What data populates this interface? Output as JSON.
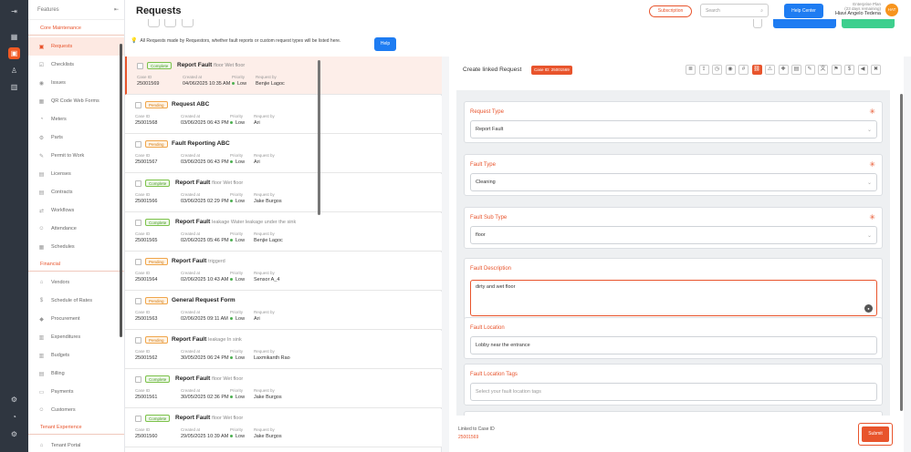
{
  "rail": {
    "icons": [
      "expand-icon",
      "dashboard-icon",
      "requests-icon",
      "hierarchy-icon",
      "reports-icon",
      "settings-icon",
      "help-icon",
      "gear-icon"
    ]
  },
  "sidebar": {
    "header": "Features",
    "sections": [
      {
        "title": "Core Maintenance",
        "items": [
          {
            "label": "Requests",
            "icon": "requests-icon",
            "active": true
          },
          {
            "label": "Checklists",
            "icon": "checklist-icon"
          },
          {
            "label": "Issues",
            "icon": "issues-icon"
          },
          {
            "label": "QR Code Web Forms",
            "icon": "qr-icon"
          },
          {
            "label": "Meters",
            "icon": "meter-icon"
          },
          {
            "label": "Parts",
            "icon": "parts-icon"
          },
          {
            "label": "Permit to Work",
            "icon": "permit-icon"
          },
          {
            "label": "Licenses",
            "icon": "license-icon"
          },
          {
            "label": "Contracts",
            "icon": "contract-icon"
          },
          {
            "label": "Workflows",
            "icon": "workflow-icon"
          },
          {
            "label": "Attendance",
            "icon": "attendance-icon"
          },
          {
            "label": "Schedules",
            "icon": "schedule-icon"
          }
        ]
      },
      {
        "title": "Financial",
        "items": [
          {
            "label": "Vendors",
            "icon": "vendor-icon"
          },
          {
            "label": "Schedule of Rates",
            "icon": "dollar-icon"
          },
          {
            "label": "Procurement",
            "icon": "procurement-icon"
          },
          {
            "label": "Expenditures",
            "icon": "expenditure-icon"
          },
          {
            "label": "Budgets",
            "icon": "budget-icon"
          },
          {
            "label": "Billing",
            "icon": "billing-icon"
          },
          {
            "label": "Payments",
            "icon": "payment-icon"
          },
          {
            "label": "Customers",
            "icon": "customers-icon"
          }
        ]
      },
      {
        "title": "Tenant Experience",
        "items": [
          {
            "label": "Tenant Portal",
            "icon": "portal-icon"
          }
        ]
      }
    ]
  },
  "header": {
    "title": "Requests",
    "subscription": "Subscription",
    "search_placeholder": "Search",
    "help_center": "Help Center",
    "plan": "Enterprise Plan",
    "trial": "(23 days remaining)",
    "user": "Hiavi Angelo Tedena",
    "initials": "HAT",
    "info": "All Requests made by Requestors, whether fault reports or custom request types will be listed here.",
    "help": "Help"
  },
  "list": {
    "labels": {
      "case": "Case ID",
      "created": "Created at",
      "priority": "Priority",
      "requested": "Request by"
    },
    "items": [
      {
        "status": "Complete",
        "title": "Report Fault",
        "sub": "floor Wet floor",
        "id": "25001569",
        "created": "04/06/2025 10:35 AM",
        "priority": "Low",
        "by": "Benjie Lagoc",
        "selected": true
      },
      {
        "status": "Pending",
        "title": "Request ABC",
        "sub": "",
        "id": "25001568",
        "created": "03/06/2025 06:43 PM",
        "priority": "Low",
        "by": "Ari"
      },
      {
        "status": "Pending",
        "title": "Fault Reporting ABC",
        "sub": "",
        "id": "25001567",
        "created": "03/06/2025 06:43 PM",
        "priority": "Low",
        "by": "Ari"
      },
      {
        "status": "Complete",
        "title": "Report Fault",
        "sub": "floor Wet floor",
        "id": "25001566",
        "created": "03/06/2025 02:29 PM",
        "priority": "Low",
        "by": "Jake Burgos"
      },
      {
        "status": "Complete",
        "title": "Report Fault",
        "sub": "leakage Water leakage under the sink",
        "id": "25001565",
        "created": "02/06/2025 05:46 PM",
        "priority": "Low",
        "by": "Benjie Lagoc"
      },
      {
        "status": "Pending",
        "title": "Report Fault",
        "sub": "triggerd",
        "id": "25001564",
        "created": "02/06/2025 10:43 AM",
        "priority": "Low",
        "by": "Sensor A_4"
      },
      {
        "status": "Pending",
        "title": "General Request Form",
        "sub": "",
        "id": "25001563",
        "created": "02/06/2025 09:11 AM",
        "priority": "Low",
        "by": "Ari"
      },
      {
        "status": "Pending",
        "title": "Report Fault",
        "sub": "leakage In sink",
        "id": "25001562",
        "created": "30/05/2025 06:24 PM",
        "priority": "Low",
        "by": "Laxmikanth Rao"
      },
      {
        "status": "Complete",
        "title": "Report Fault",
        "sub": "floor Wet floor",
        "id": "25001561",
        "created": "30/05/2025 02:36 PM",
        "priority": "Low",
        "by": "Jake Burgos"
      },
      {
        "status": "Complete",
        "title": "Report Fault",
        "sub": "floor Wet floor",
        "id": "25001560",
        "created": "29/05/2025 10:39 AM",
        "priority": "Low",
        "by": "Jake Burgos"
      }
    ]
  },
  "form": {
    "title": "Create linked Request",
    "case_badge": "Case ID: 25001569",
    "toolbar": [
      "notes-icon",
      "upload-icon",
      "clock-icon",
      "alert-icon",
      "hash-icon",
      "link-icon",
      "warning-icon",
      "puzzle-icon",
      "printer-icon",
      "pencil-icon",
      "translate-icon",
      "flag-icon",
      "dollar-icon",
      "speaker-icon",
      "trash-icon"
    ],
    "fields": {
      "request_type": {
        "label": "Request Type",
        "value": "Report Fault"
      },
      "fault_type": {
        "label": "Fault Type",
        "value": "Cleaning"
      },
      "fault_sub_type": {
        "label": "Fault Sub Type",
        "value": "floor"
      },
      "fault_description": {
        "label": "Fault Description",
        "value": "dirty and wet floor"
      },
      "fault_location": {
        "label": "Fault Location",
        "value": "Lobby near the entrance"
      },
      "fault_location_tags": {
        "label": "Fault Location Tags",
        "placeholder": "Select your fault location tags"
      }
    },
    "linked_label": "Linked to Case ID",
    "linked_value": "25001569",
    "submit": "Submit"
  },
  "colors": {
    "accent": "#e8542c",
    "blue": "#1e7cf2",
    "rail": "#2f3640",
    "complete": "#4c9a2a",
    "pending": "#d37a10"
  }
}
